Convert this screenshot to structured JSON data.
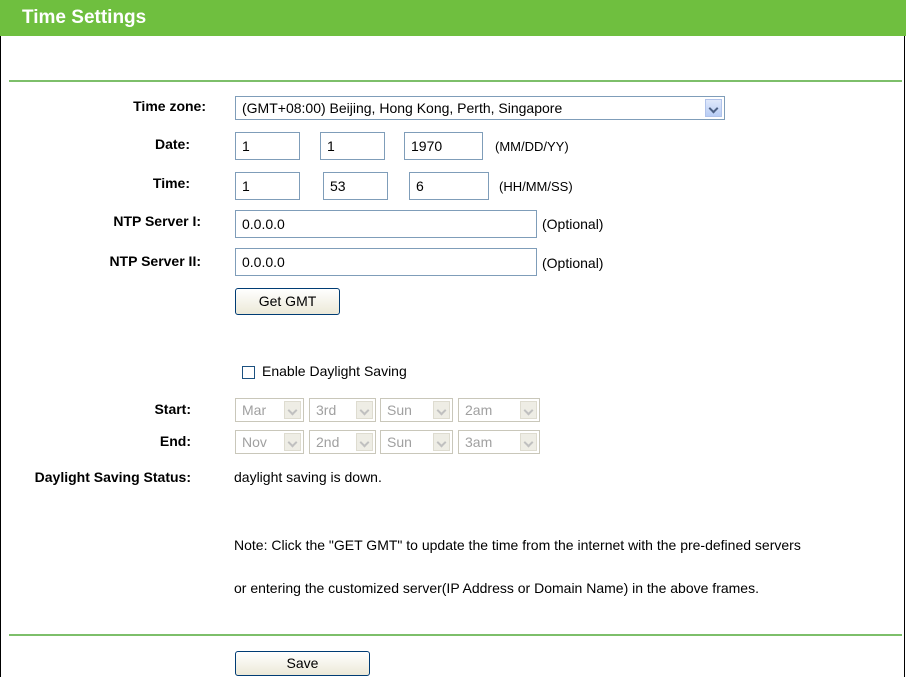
{
  "title": "Time Settings",
  "form": {
    "time_zone": {
      "label": "Time zone:",
      "value": "(GMT+08:00) Beijing, Hong Kong, Perth, Singapore"
    },
    "date": {
      "label": "Date:",
      "month": "1",
      "day": "1",
      "year": "1970",
      "hint": "(MM/DD/YY)"
    },
    "time": {
      "label": "Time:",
      "hour": "1",
      "minute": "53",
      "second": "6",
      "hint": "(HH/MM/SS)"
    },
    "ntp1": {
      "label": "NTP Server I:",
      "value": "0.0.0.0",
      "hint": "(Optional)"
    },
    "ntp2": {
      "label": "NTP Server II:",
      "value": "0.0.0.0",
      "hint": "(Optional)"
    },
    "get_gmt_label": "Get GMT",
    "daylight": {
      "checkbox_label": "Enable Daylight Saving",
      "checked": false,
      "start": {
        "label": "Start:",
        "month": "Mar",
        "week": "3rd",
        "day": "Sun",
        "hour": "2am"
      },
      "end": {
        "label": "End:",
        "month": "Nov",
        "week": "2nd",
        "day": "Sun",
        "hour": "3am"
      },
      "status_label": "Daylight Saving Status:",
      "status_value": "daylight saving is down."
    },
    "note_line1": "Note: Click the \"GET GMT\" to update the time from the internet with the pre-defined servers",
    "note_line2": "or entering the customized server(IP Address or Domain Name) in the above frames.",
    "save_label": "Save"
  }
}
